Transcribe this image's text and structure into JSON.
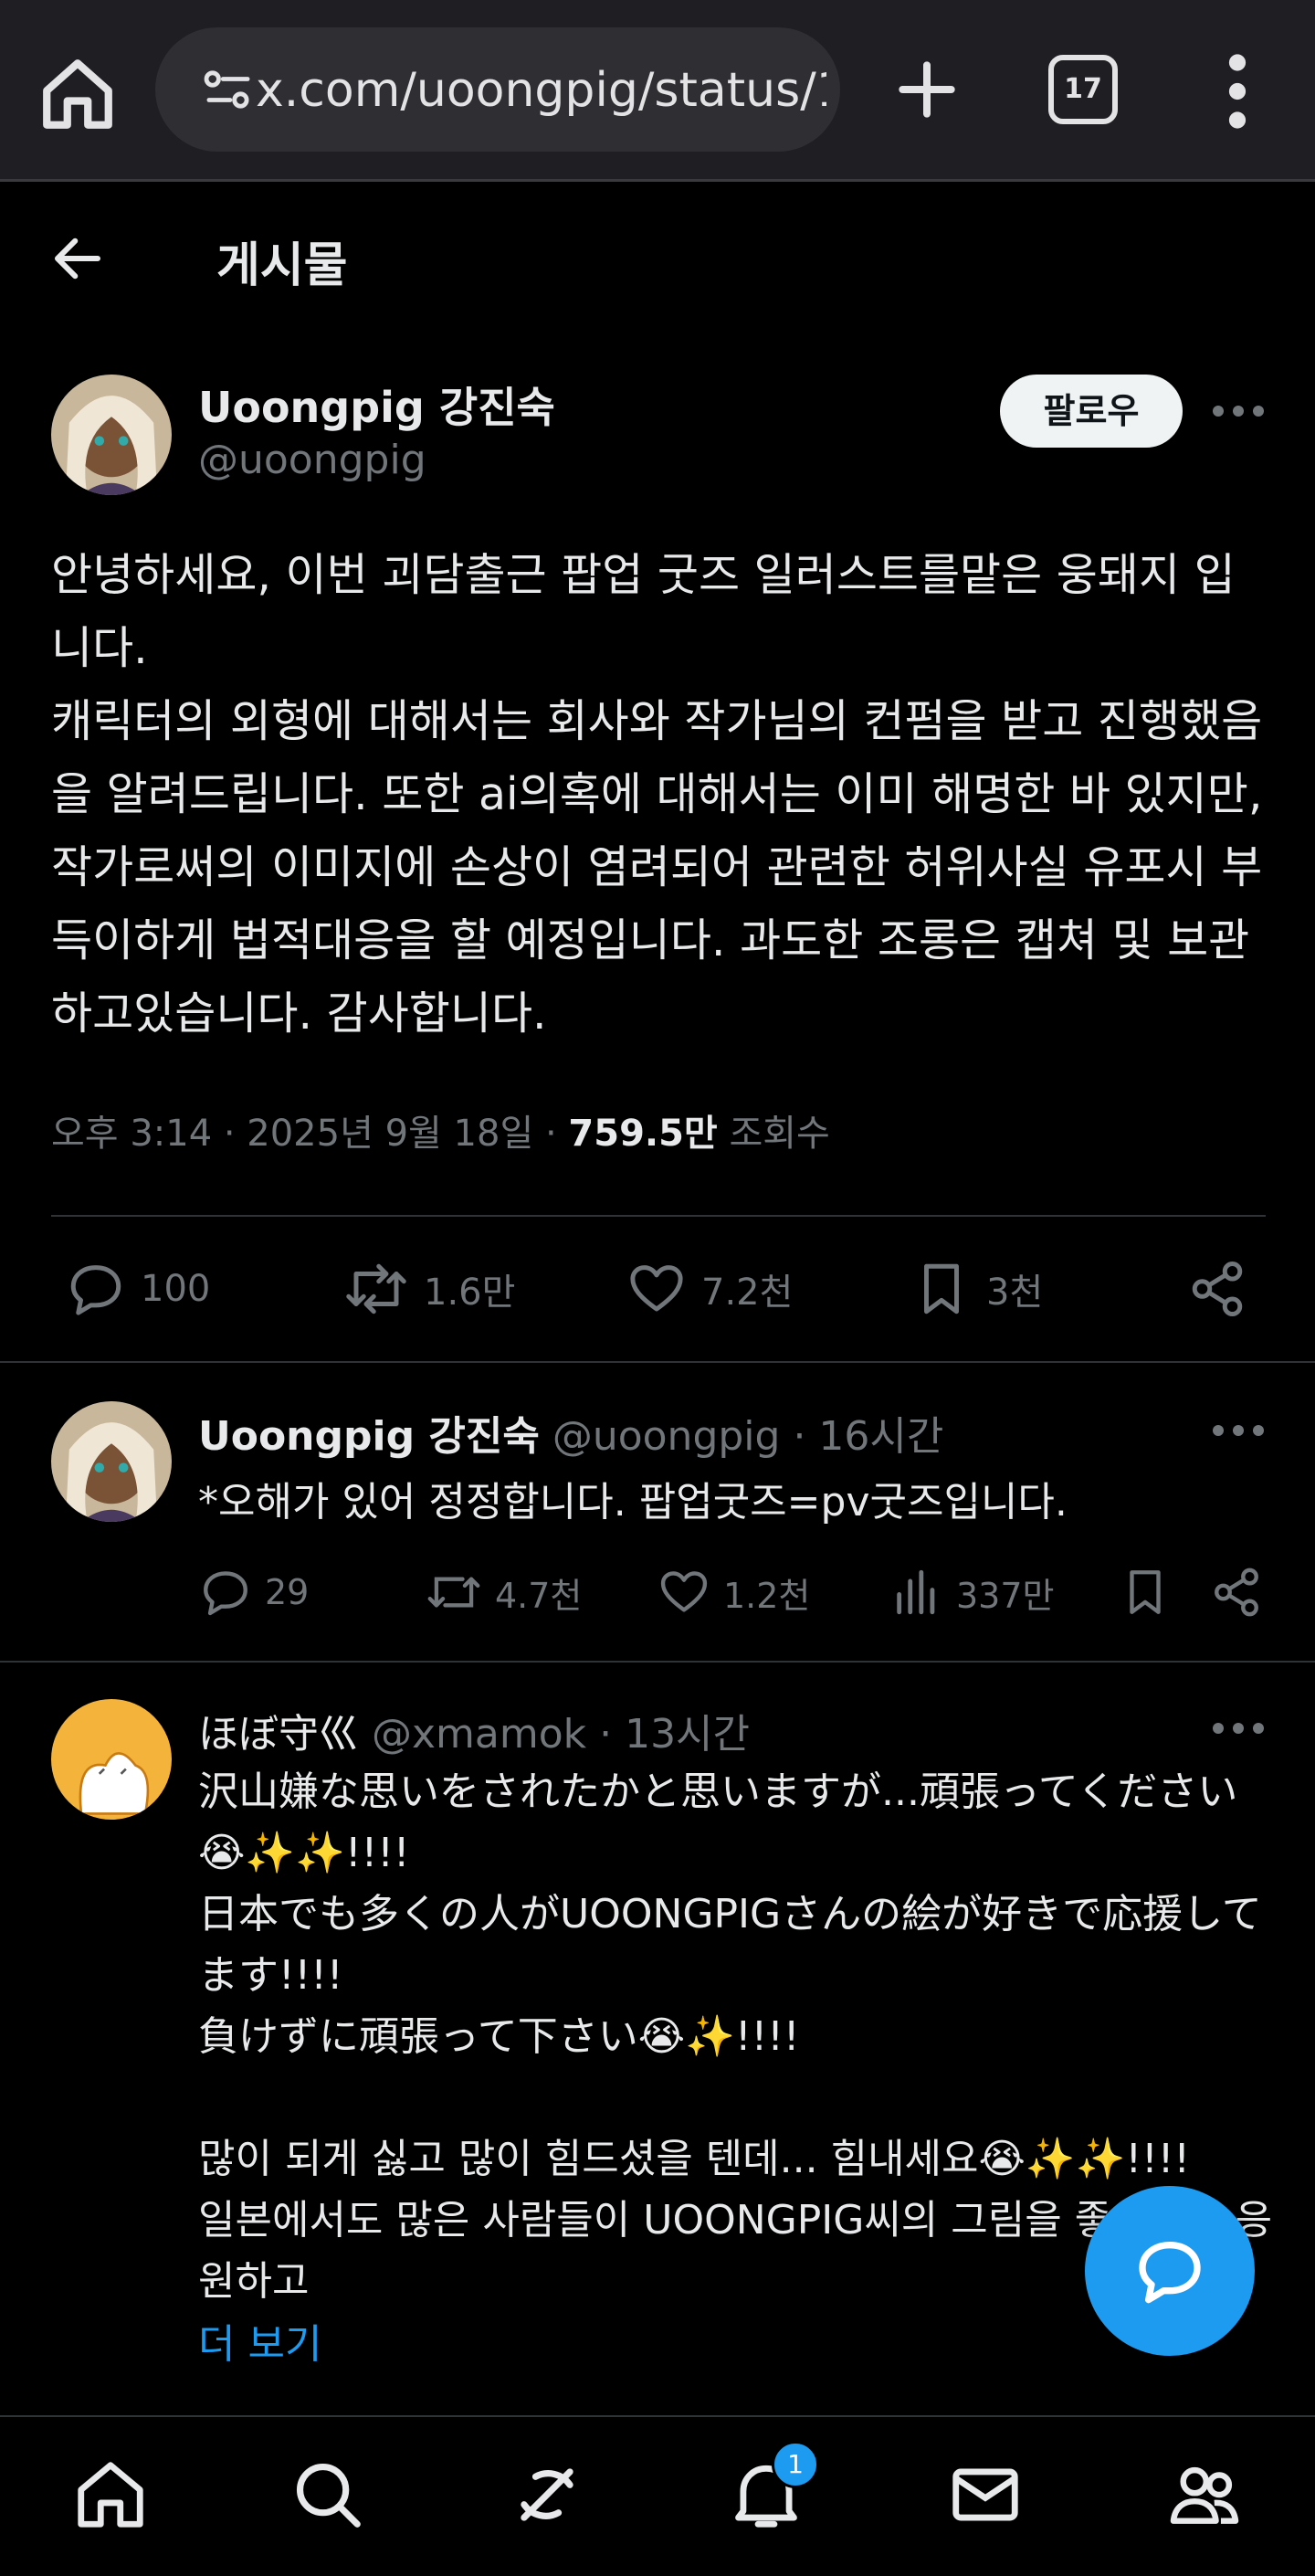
{
  "browser": {
    "url": "x.com/uoongpig/status/1",
    "tab_count": "17"
  },
  "page": {
    "title": "게시물"
  },
  "post": {
    "author_name": "Uoongpig 강진숙",
    "author_handle": "@uoongpig",
    "follow_label": "팔로우",
    "text": [
      "안녕하세요, 이번 괴담출근 팝업 굿즈 일러스트를맡은 웅돼지 입니다.",
      "캐릭터의 외형에 대해서는 회사와 작가님의 컨펌을 받고 진행했음을 알려드립니다. 또한 ai의혹에 대해서는 이미 해명한 바 있지만, 작가로써의 이미지에 손상이 염려되어 관련한 허위사실 유포시 부득이하게 법적대응을 할 예정입니다. 과도한 조롱은 캡쳐 및 보관하고있습니다. 감사합니다."
    ],
    "timestamp": "오후 3:14 · 2025년 9월 18일 · ",
    "views_count": "759.5만",
    "views_label": " 조회수",
    "stats": {
      "replies": "100",
      "reposts": "1.6만",
      "likes": "7.2천",
      "bookmarks": "3천"
    }
  },
  "replies": [
    {
      "author_name": "Uoongpig 강진숙",
      "meta": " @uoongpig · 16시간",
      "text": "*오해가 있어 정정합니다. 팝업굿즈=pv굿즈입니다.",
      "stats": {
        "replies": "29",
        "reposts": "4.7천",
        "likes": "1.2천",
        "views": "337만"
      }
    },
    {
      "author_name": "ほぼ守巛",
      "meta": " @xmamok · 13시간",
      "text": [
        "沢山嫌な思いをされたかと思いますが...頑張ってください😭✨✨!!!!",
        "日本でも多くの人がUOONGPIGさんの絵が好きで応援してます!!!!",
        "負けずに頑張って下さい😭✨!!!!",
        "",
        "많이 되게 싫고 많이 힘드셨을 텐데... 힘내세요😭✨✨!!!!",
        "일본에서도 많은 사람들이 UOONGPIG씨의 그림을 좋아하고 응원하고"
      ],
      "more_label": "더 보기"
    }
  ],
  "nav": {
    "notification_badge": "1"
  },
  "colors": {
    "accent": "#1d9bf0",
    "background": "#000000",
    "muted": "#71767b"
  }
}
